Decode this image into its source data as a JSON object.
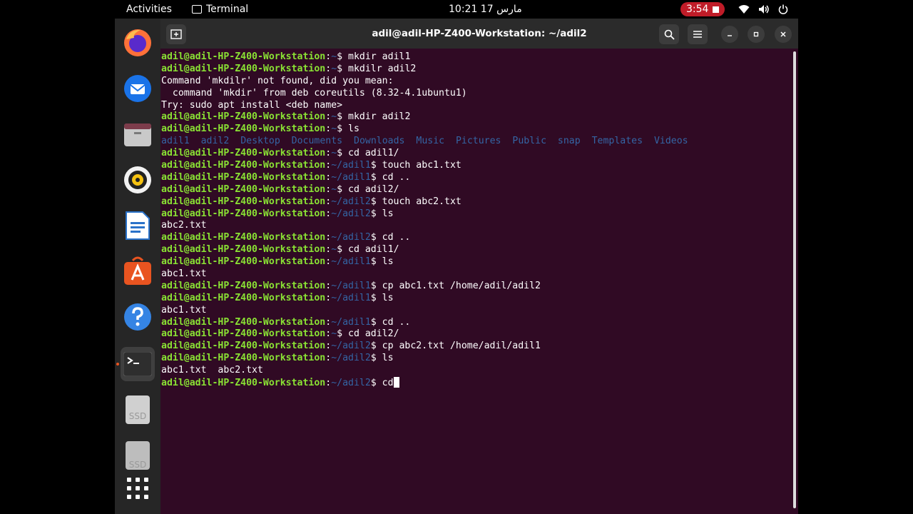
{
  "topbar": {
    "activities": "Activities",
    "app_name": "Terminal",
    "clock": "10:21 مارس 17",
    "recording_time": "3:54"
  },
  "dock": [
    {
      "name": "firefox"
    },
    {
      "name": "thunderbird"
    },
    {
      "name": "files"
    },
    {
      "name": "rhythmbox"
    },
    {
      "name": "libreoffice-writer"
    },
    {
      "name": "software"
    },
    {
      "name": "help"
    },
    {
      "name": "terminal"
    },
    {
      "name": "ssd-drive-1",
      "label": "SSD"
    },
    {
      "name": "ssd-drive-2",
      "label": "SSD"
    },
    {
      "name": "show-apps"
    }
  ],
  "window": {
    "title": "adil@adil-HP-Z400-Workstation: ~/adil2"
  },
  "terminal": {
    "prompt_user": "adil@adil-HP-Z400-Workstation",
    "lines": [
      {
        "type": "prompt",
        "path": "~",
        "cmd": "mkdir adil1"
      },
      {
        "type": "prompt",
        "path": "~",
        "cmd": "mkdilr adil2"
      },
      {
        "type": "text",
        "text": "Command 'mkdilr' not found, did you mean:"
      },
      {
        "type": "text",
        "text": "  command 'mkdir' from deb coreutils (8.32-4.1ubuntu1)"
      },
      {
        "type": "text",
        "text": "Try: sudo apt install <deb name>"
      },
      {
        "type": "prompt",
        "path": "~",
        "cmd": "mkdir adil2"
      },
      {
        "type": "prompt",
        "path": "~",
        "cmd": "ls"
      },
      {
        "type": "dirs",
        "items": [
          "adil1",
          "adil2",
          "Desktop",
          "Documents",
          "Downloads",
          "Music",
          "Pictures",
          "Public",
          "snap",
          "Templates",
          "Videos"
        ]
      },
      {
        "type": "prompt",
        "path": "~",
        "cmd": "cd adil1/"
      },
      {
        "type": "prompt",
        "path": "~/adil1",
        "cmd": "touch abc1.txt"
      },
      {
        "type": "prompt",
        "path": "~/adil1",
        "cmd": "cd .."
      },
      {
        "type": "prompt",
        "path": "~",
        "cmd": "cd adil2/"
      },
      {
        "type": "prompt",
        "path": "~/adil2",
        "cmd": "touch abc2.txt"
      },
      {
        "type": "prompt",
        "path": "~/adil2",
        "cmd": "ls"
      },
      {
        "type": "text",
        "text": "abc2.txt"
      },
      {
        "type": "prompt",
        "path": "~/adil2",
        "cmd": "cd .."
      },
      {
        "type": "prompt",
        "path": "~",
        "cmd": "cd adil1/"
      },
      {
        "type": "prompt",
        "path": "~/adil1",
        "cmd": "ls"
      },
      {
        "type": "text",
        "text": "abc1.txt"
      },
      {
        "type": "prompt",
        "path": "~/adil1",
        "cmd": "cp abc1.txt /home/adil/adil2"
      },
      {
        "type": "prompt",
        "path": "~/adil1",
        "cmd": "ls"
      },
      {
        "type": "text",
        "text": "abc1.txt"
      },
      {
        "type": "prompt",
        "path": "~/adil1",
        "cmd": "cd .."
      },
      {
        "type": "prompt",
        "path": "~",
        "cmd": "cd adil2/"
      },
      {
        "type": "prompt",
        "path": "~/adil2",
        "cmd": "cp abc2.txt /home/adil/adil1"
      },
      {
        "type": "prompt",
        "path": "~/adil2",
        "cmd": "ls"
      },
      {
        "type": "text",
        "text": "abc1.txt  abc2.txt"
      },
      {
        "type": "prompt",
        "path": "~/adil2",
        "cmd": "cd",
        "cursor": true
      }
    ]
  },
  "colors": {
    "terminal_bg": "#300a24",
    "prompt_user": "#8ae234",
    "prompt_path": "#3465a4",
    "dir_listing": "#3465a4",
    "record_badge": "#c01c28"
  }
}
